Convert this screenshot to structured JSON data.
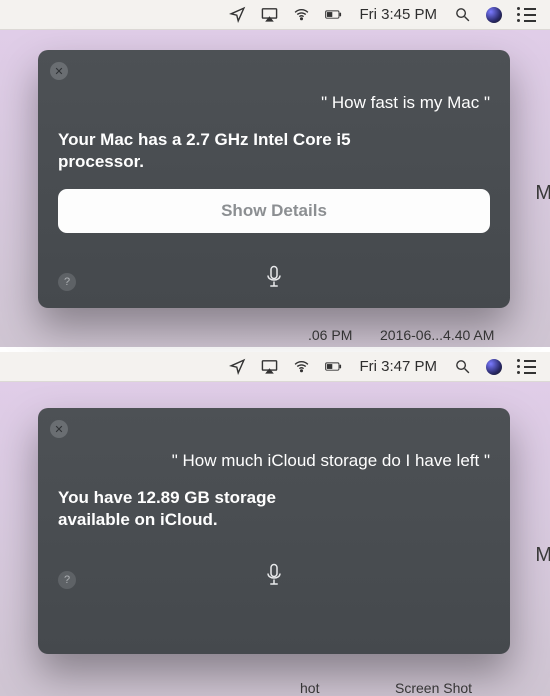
{
  "top": {
    "menubar": {
      "clock": "Fri 3:45 PM"
    },
    "panel": {
      "query": "\" How fast is my Mac \"",
      "response": "Your Mac has a 2.7 GHz Intel Core i5 processor.",
      "details_label": "Show Details"
    },
    "behind": {
      "label1": ".06 PM",
      "label2": "2016-06...4.40 AM",
      "stray": "M"
    }
  },
  "bottom": {
    "menubar": {
      "clock": "Fri 3:47 PM"
    },
    "panel": {
      "query": "\" How much iCloud storage do I have left \"",
      "response": "You have 12.89 GB storage available on iCloud."
    },
    "behind": {
      "label1": "hot",
      "label2": "Screen Shot",
      "stray": "M"
    }
  }
}
